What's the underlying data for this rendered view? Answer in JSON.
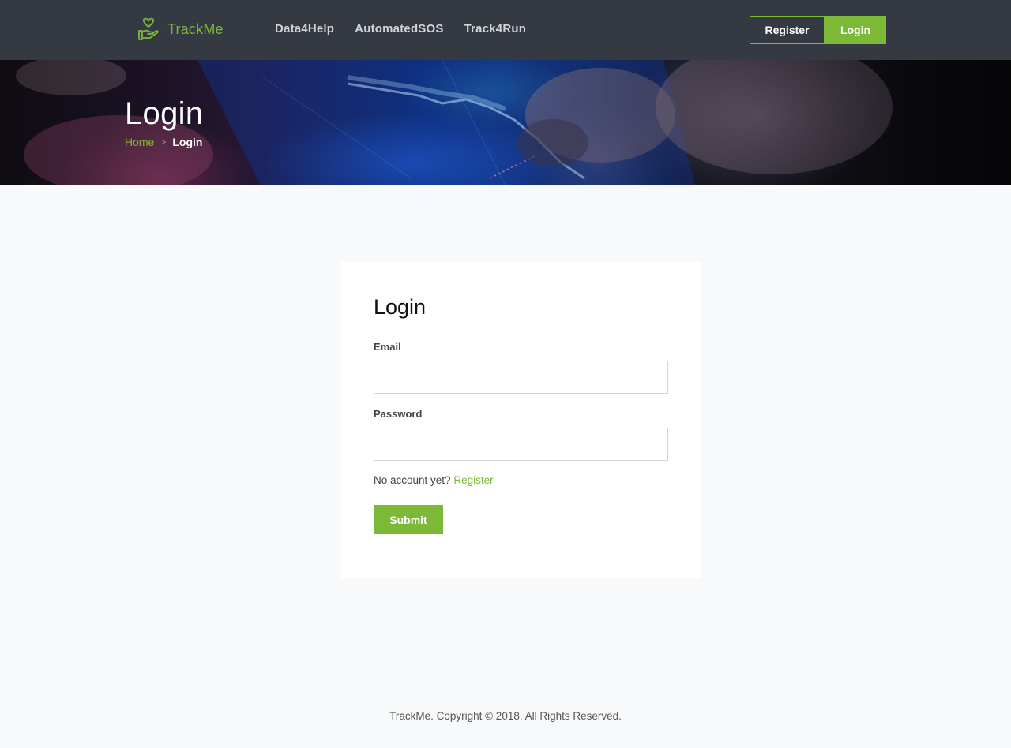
{
  "header": {
    "brand": "TrackMe",
    "nav": [
      "Data4Help",
      "AutomatedSOS",
      "Track4Run"
    ],
    "register_label": "Register",
    "login_label": "Login"
  },
  "hero": {
    "title": "Login",
    "breadcrumb": {
      "home": "Home",
      "separator": ">",
      "current": "Login"
    }
  },
  "form": {
    "title": "Login",
    "email_label": "Email",
    "email_value": "",
    "password_label": "Password",
    "password_value": "",
    "no_account_text": "No account yet?",
    "register_link": "Register",
    "submit_label": "Submit"
  },
  "footer": {
    "copyright": "TrackMe. Copyright © 2018. All Rights Reserved."
  },
  "colors": {
    "accent": "#7cb937",
    "header_bg": "#353a42",
    "page_bg": "#f8f9fa"
  },
  "icons": {
    "brand_logo": "heart-hand-icon"
  }
}
